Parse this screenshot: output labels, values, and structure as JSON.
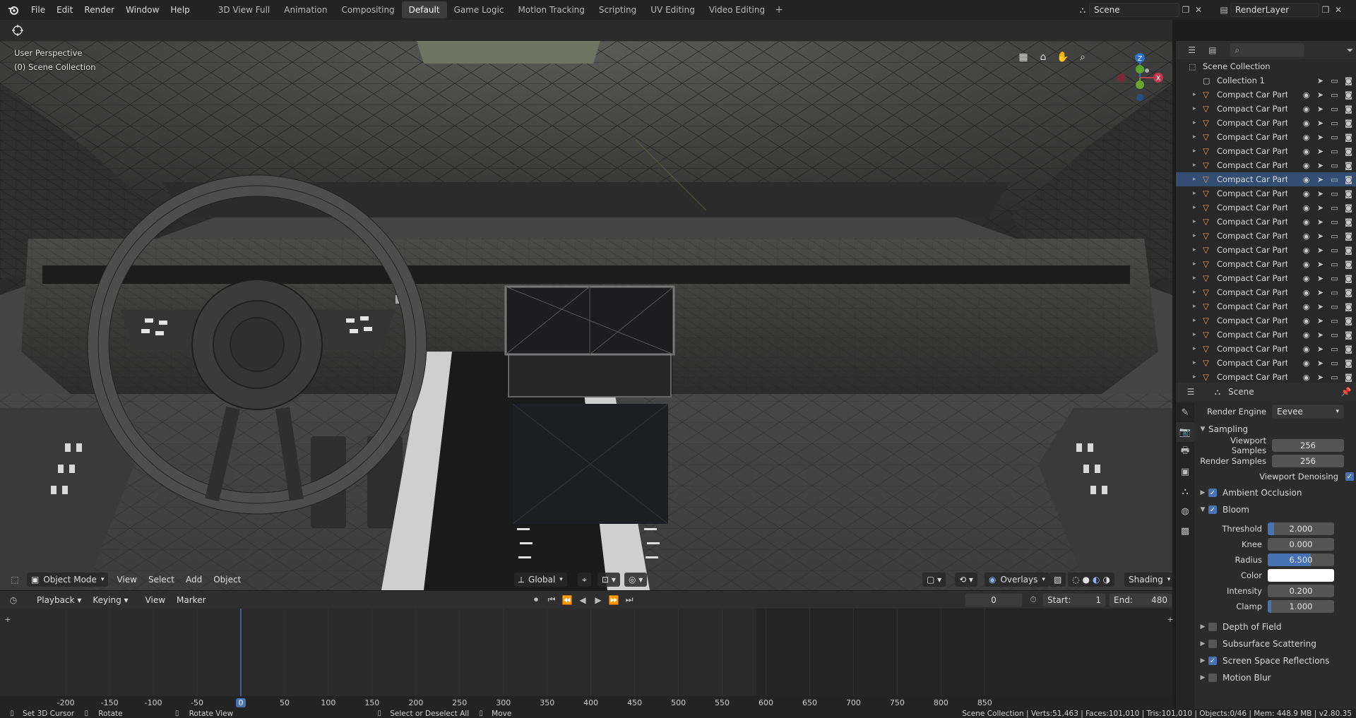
{
  "menu": {
    "items": [
      "File",
      "Edit",
      "Render",
      "Window",
      "Help"
    ]
  },
  "workspaces": {
    "tabs": [
      "3D View Full",
      "Animation",
      "Compositing",
      "Default",
      "Game Logic",
      "Motion Tracking",
      "Scripting",
      "UV Editing",
      "Video Editing"
    ],
    "active": "Default"
  },
  "scene_selector": {
    "label": "Scene"
  },
  "layer_selector": {
    "label": "RenderLayer"
  },
  "viewport": {
    "perspective": "User Perspective",
    "collection": "(0) Scene Collection",
    "mode": "Object Mode",
    "menus": [
      "View",
      "Select",
      "Add",
      "Object"
    ],
    "orientation": "Global",
    "overlays": "Overlays",
    "shading": "Shading",
    "gizmo": {
      "z": "Z",
      "x": "X"
    }
  },
  "timeline": {
    "menus": [
      "Playback",
      "Keying",
      "View",
      "Marker"
    ],
    "current_frame": "0",
    "start_label": "Start:",
    "start": "1",
    "end_label": "End:",
    "end": "480",
    "ruler": [
      "-200",
      "-150",
      "-100",
      "-50",
      "0",
      "50",
      "100",
      "150",
      "200",
      "250",
      "300",
      "350",
      "400",
      "450",
      "500",
      "550",
      "600",
      "650",
      "700",
      "750",
      "800",
      "850"
    ]
  },
  "outliner": {
    "root": "Scene Collection",
    "collection": "Collection 1",
    "items": [
      "Compact Car Part.0(",
      "Compact Car Part.0(",
      "Compact Car Part.0(",
      "Compact Car Part.0(",
      "Compact Car Part.0",
      "Compact Car Part.0",
      "Compact Car Part.0",
      "Compact Car Part.0",
      "Compact Car Part.0",
      "Compact Car Part.0",
      "Compact Car Part.0",
      "Compact Car Part.0",
      "Compact Car Part.0",
      "Compact Car Part.0",
      "Compact Car Part.0",
      "Compact Car Part.0",
      "Compact Car Part.0",
      "Compact Car Part.0",
      "Compact Car Part.0",
      "Compact Car Part.0",
      "Compact Car Part.0"
    ],
    "selected_index": 6
  },
  "properties": {
    "context": "Scene",
    "render_engine_label": "Render Engine",
    "render_engine": "Eevee",
    "sampling": {
      "title": "Sampling",
      "viewport_samples_label": "Viewport Samples",
      "viewport_samples": "256",
      "render_samples_label": "Render Samples",
      "render_samples": "256",
      "denoising_label": "Viewport Denoising"
    },
    "ambient_occlusion": "Ambient Occlusion",
    "bloom": {
      "title": "Bloom",
      "threshold_label": "Threshold",
      "threshold": "2.000",
      "threshold_fill": 0.1,
      "knee_label": "Knee",
      "knee": "0.000",
      "knee_fill": 0,
      "radius_label": "Radius",
      "radius": "6.500",
      "radius_fill": 0.65,
      "color_label": "Color",
      "intensity_label": "Intensity",
      "intensity": "0.200",
      "intensity_fill": 0,
      "clamp_label": "Clamp",
      "clamp": "1.000",
      "clamp_fill": 0.05
    },
    "depth_of_field": "Depth of Field",
    "subsurface": "Subsurface Scattering",
    "ssr": "Screen Space Reflections",
    "motion_blur": "Motion Blur"
  },
  "status": {
    "set_cursor": "Set 3D Cursor",
    "rotate": "Rotate",
    "rotate_view": "Rotate View",
    "select": "Select or Deselect All",
    "move": "Move",
    "stats": "Scene Collection | Verts:51,463 | Faces:101,010 | Tris:101,010 | Objects:0/46 | Mem: 448.9 MB | v2.80.35"
  },
  "colors": {
    "accent": "#4772b3",
    "selection": "#334d73",
    "object_icon": "#e89a4a"
  }
}
